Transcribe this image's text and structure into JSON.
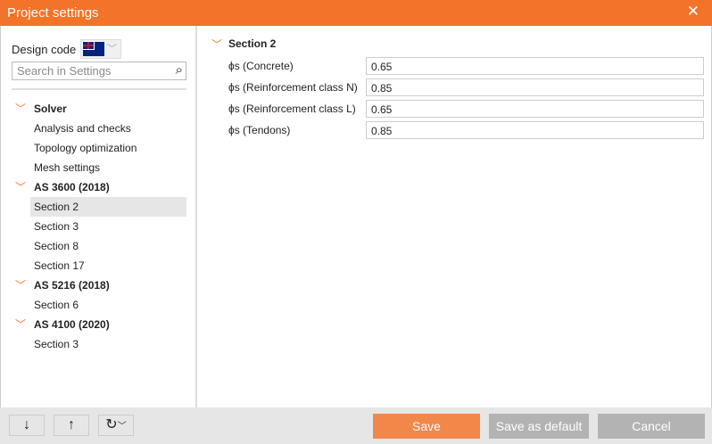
{
  "window": {
    "title": "Project settings"
  },
  "sidebar": {
    "design_code_label": "Design code",
    "design_code_flag": "australia-flag",
    "search_placeholder": "Search in Settings",
    "groups": [
      {
        "label": "Solver",
        "items": [
          "Analysis and checks",
          "Topology optimization",
          "Mesh settings"
        ]
      },
      {
        "label": "AS 3600 (2018)",
        "items": [
          "Section 2",
          "Section 3",
          "Section 8",
          "Section 17"
        ]
      },
      {
        "label": "AS 5216 (2018)",
        "items": [
          "Section 6"
        ]
      },
      {
        "label": "AS 4100 (2020)",
        "items": [
          "Section 3"
        ]
      }
    ],
    "selected": "AS 3600 (2018) / Section 2"
  },
  "main": {
    "section_title": "Section 2",
    "properties": [
      {
        "label": "ϕs (Concrete)",
        "value": "0.65"
      },
      {
        "label": "ϕs (Reinforcement class N)",
        "value": "0.85"
      },
      {
        "label": "ϕs (Reinforcement class L)",
        "value": "0.65"
      },
      {
        "label": "ϕs (Tendons)",
        "value": "0.85"
      }
    ]
  },
  "footer": {
    "down": "↓",
    "up": "↑",
    "reset": "↻",
    "save": "Save",
    "save_default": "Save as default",
    "cancel": "Cancel"
  },
  "colors": {
    "accent": "#f37328",
    "save": "#f2874a",
    "disabled": "#b3b3b3"
  }
}
